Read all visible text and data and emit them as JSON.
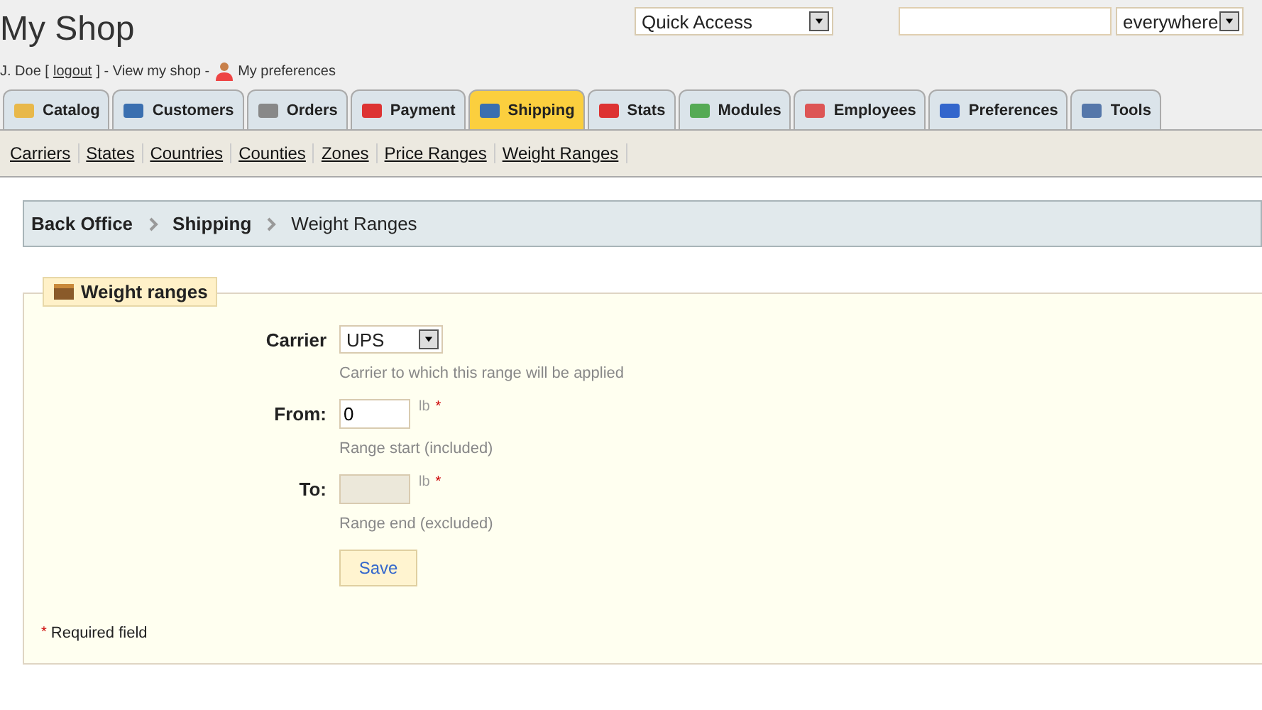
{
  "header": {
    "shop_name": "My Shop",
    "user": "J. Doe [",
    "logout": "logout",
    "user_end": "] - View my shop -",
    "preferences": "My preferences",
    "quick_access": "Quick Access",
    "search_scope": "everywhere"
  },
  "tabs": [
    {
      "label": "Catalog",
      "selected": false
    },
    {
      "label": "Customers",
      "selected": false
    },
    {
      "label": "Orders",
      "selected": false
    },
    {
      "label": "Payment",
      "selected": false
    },
    {
      "label": "Shipping",
      "selected": true
    },
    {
      "label": "Stats",
      "selected": false
    },
    {
      "label": "Modules",
      "selected": false
    },
    {
      "label": "Employees",
      "selected": false
    },
    {
      "label": "Preferences",
      "selected": false
    },
    {
      "label": "Tools",
      "selected": false
    }
  ],
  "subtabs": [
    "Carriers",
    "States",
    "Countries",
    "Counties",
    "Zones",
    "Price Ranges",
    "Weight Ranges"
  ],
  "breadcrumb": [
    "Back Office",
    "Shipping",
    "Weight Ranges"
  ],
  "form": {
    "legend": "Weight ranges",
    "fields": [
      {
        "kind": "select",
        "label": "Carrier",
        "value": "UPS",
        "hint": "Carrier to which this range will be applied"
      },
      {
        "kind": "input",
        "label": "From:",
        "value": "0",
        "unit": "lb",
        "required": "*",
        "hint": "Range start (included)"
      },
      {
        "kind": "input",
        "label": "To:",
        "unit": "lb",
        "required": "*",
        "hint": "Range end (excluded)",
        "focused": true
      }
    ],
    "save": "Save",
    "required_mark": "*",
    "required_text": "Required field"
  }
}
